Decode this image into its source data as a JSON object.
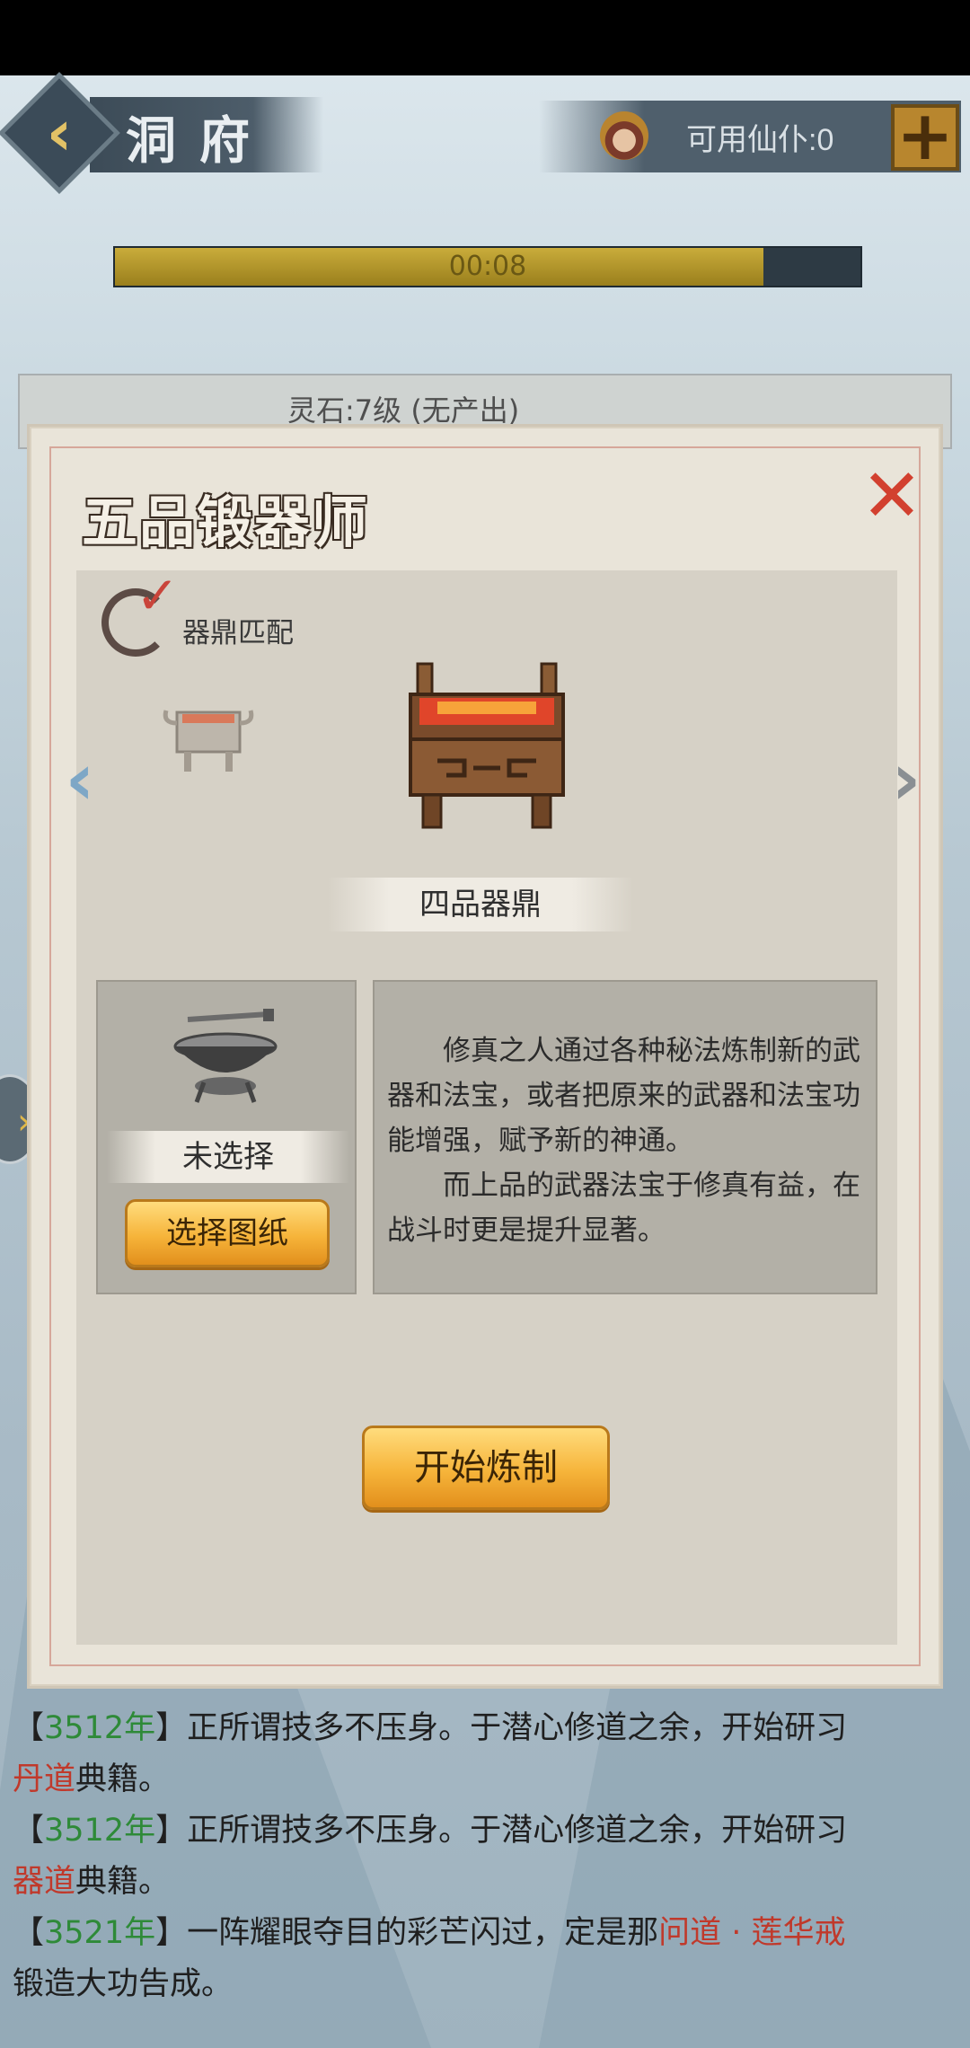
{
  "header": {
    "title": "洞府",
    "servants_label": "可用仙仆:0",
    "plus_label": "+"
  },
  "timer": {
    "text": "00:08",
    "progress_fraction": 0.87
  },
  "background_card": {
    "text": "灵石:7级 (无产出)"
  },
  "dialog": {
    "title": "五品锻器师",
    "close_label": "✕",
    "match_label": "器鼎匹配",
    "cauldron_name": "四品器鼎",
    "blueprint_status": "未选择",
    "select_blueprint_label": "选择图纸",
    "description": [
      "修真之人通过各种秘法炼制新的武器和法宝，或者把原来的武器和法宝功能增强，赋予新的神通。",
      "而上品的武器法宝于修真有益，在战斗时更是提升显著。"
    ],
    "start_label": "开始炼制"
  },
  "log": [
    {
      "pre": "【",
      "year": "3512年",
      "mid": "】正所谓技多不压身。于潜心修道之余，开始研习",
      "hl": "丹道",
      "post": "典籍。"
    },
    {
      "pre": "【",
      "year": "3512年",
      "mid": "】正所谓技多不压身。于潜心修道之余，开始研习",
      "hl": "器道",
      "post": "典籍。"
    },
    {
      "pre": "【",
      "year": "3521年",
      "mid": "】一阵耀眼夺目的彩芒闪过，定是那",
      "hl": "问道 · 莲华戒",
      "post": "锻造大功告成。"
    }
  ],
  "colors": {
    "accent_gold": "#f6b43a",
    "year_green": "#2e8a38",
    "highlight_red": "#c0392b",
    "close_red": "#d2402f"
  }
}
